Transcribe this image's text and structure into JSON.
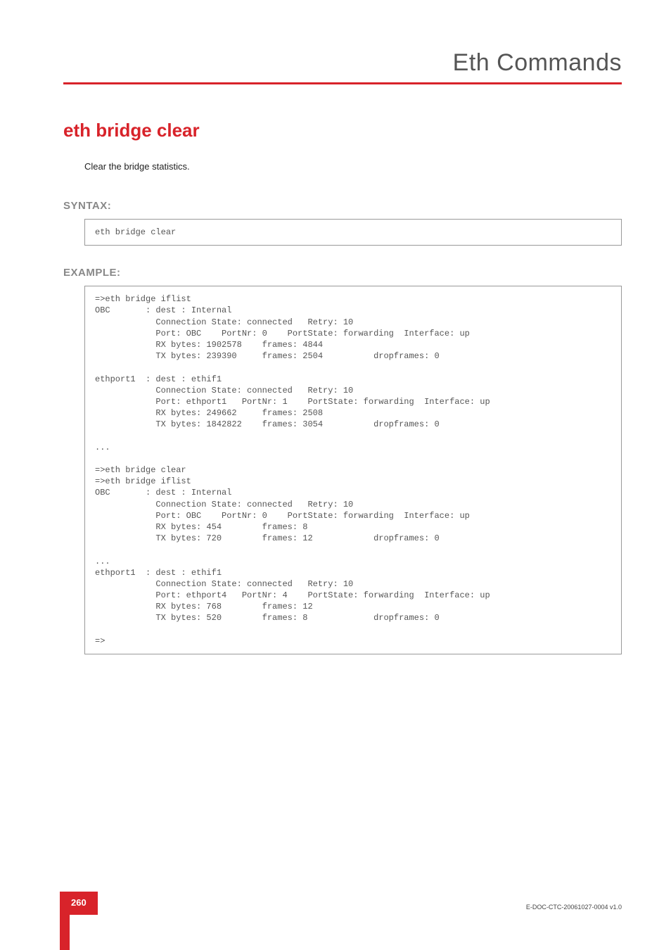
{
  "header": {
    "title": "Eth Commands"
  },
  "command": {
    "title": "eth bridge clear",
    "description": "Clear the bridge statistics."
  },
  "sections": {
    "syntax_label": "SYNTAX:",
    "syntax_code": "eth bridge clear",
    "example_label": "EXAMPLE:",
    "example_code": "=>eth bridge iflist\nOBC       : dest : Internal\n            Connection State: connected   Retry: 10\n            Port: OBC    PortNr: 0    PortState: forwarding  Interface: up\n            RX bytes: 1902578    frames: 4844\n            TX bytes: 239390     frames: 2504          dropframes: 0\n\nethport1  : dest : ethif1\n            Connection State: connected   Retry: 10\n            Port: ethport1   PortNr: 1    PortState: forwarding  Interface: up\n            RX bytes: 249662     frames: 2508\n            TX bytes: 1842822    frames: 3054          dropframes: 0\n\n...\n\n=>eth bridge clear\n=>eth bridge iflist\nOBC       : dest : Internal\n            Connection State: connected   Retry: 10\n            Port: OBC    PortNr: 0    PortState: forwarding  Interface: up\n            RX bytes: 454        frames: 8\n            TX bytes: 720        frames: 12            dropframes: 0\n\n...\nethport1  : dest : ethif1\n            Connection State: connected   Retry: 10\n            Port: ethport4   PortNr: 4    PortState: forwarding  Interface: up\n            RX bytes: 768        frames: 12\n            TX bytes: 520        frames: 8             dropframes: 0\n\n=>"
  },
  "footer": {
    "page_number": "260",
    "doc_id": "E-DOC-CTC-20061027-0004 v1.0"
  }
}
